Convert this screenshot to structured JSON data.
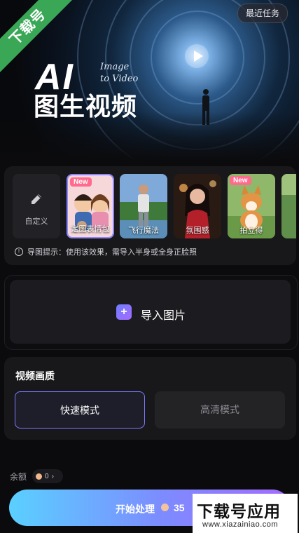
{
  "header": {
    "recent_tasks": "最近任务"
  },
  "banner": {
    "title_ai": "AI",
    "title_cn": "图生视频",
    "script_line1": "Image",
    "script_line2": "to Video"
  },
  "watermark": {
    "ribbon": "下载号",
    "site_title": "下载号应用",
    "site_url": "www.xiazainiao.com"
  },
  "effects": {
    "custom_label": "自定义",
    "items": [
      {
        "label": "定图表情包",
        "badge": "New"
      },
      {
        "label": "飞行魔法",
        "badge": ""
      },
      {
        "label": "氛围感",
        "badge": ""
      },
      {
        "label": "拍立得",
        "badge": "New"
      },
      {
        "label": "",
        "badge": ""
      }
    ],
    "tip": "导图提示：使用该效果，需导入半身或全身正脸照"
  },
  "import": {
    "label": "导入图片"
  },
  "quality": {
    "title": "视频画质",
    "fast": "快速模式",
    "hd": "高清模式"
  },
  "balance": {
    "label": "余额",
    "amount": "0"
  },
  "start": {
    "label": "开始处理",
    "cost": "35"
  }
}
